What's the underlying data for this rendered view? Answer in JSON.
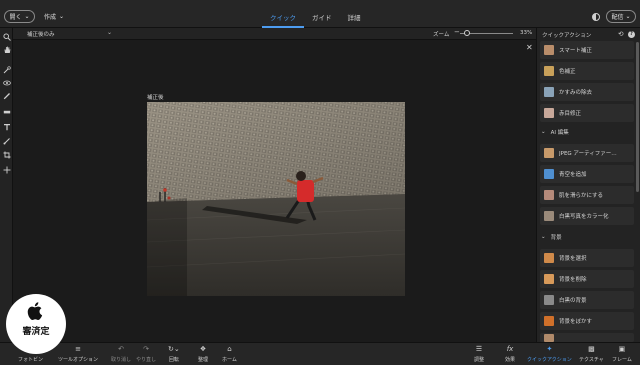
{
  "header": {
    "open_label": "開く",
    "create_label": "作成",
    "modes": [
      {
        "label": "クイック",
        "active": true
      },
      {
        "label": "ガイド",
        "active": false
      },
      {
        "label": "詳細",
        "active": false
      }
    ],
    "share_label": "配信"
  },
  "view_bar": {
    "view_mode": "補正後のみ",
    "zoom_label": "ズーム",
    "zoom_value": "33%",
    "zoom_fraction": 0.1
  },
  "canvas": {
    "after_label": "補正後"
  },
  "quick_actions": {
    "title": "クイックアクション",
    "items_top": [
      {
        "label": "スマート補正",
        "thumb_color": "#b98d6a"
      },
      {
        "label": "色補正",
        "thumb_color": "#c9a15a"
      },
      {
        "label": "かすみの除去",
        "thumb_color": "#8aa3b8"
      },
      {
        "label": "赤目修正",
        "thumb_color": "#c8a89a"
      }
    ],
    "ai_section": "AI 編集",
    "items_ai": [
      {
        "label": "JPEG アーティファー…",
        "thumb_color": "#c89a6a"
      },
      {
        "label": "青空を追加",
        "thumb_color": "#4f8fd0"
      },
      {
        "label": "肌を滑らかにする",
        "thumb_color": "#b58a7a"
      },
      {
        "label": "白黒写真をカラー化",
        "thumb_color": "#9a8a7a"
      }
    ],
    "bg_section": "背景",
    "items_bg": [
      {
        "label": "背景を選択",
        "thumb_color": "#d08a4a"
      },
      {
        "label": "背景を削除",
        "thumb_color": "#d89a5a"
      },
      {
        "label": "白黒の背景",
        "thumb_color": "#8a8a8a"
      },
      {
        "label": "背景をぼかす",
        "thumb_color": "#d0702a"
      }
    ]
  },
  "bottom_bar": {
    "left": [
      {
        "label": "フォトビン",
        "icon": "photo-bin-icon"
      },
      {
        "label": "ツールオプション",
        "icon": "tool-options-icon"
      },
      {
        "label": "取り消し",
        "icon": "undo-icon"
      },
      {
        "label": "やり直し",
        "icon": "redo-icon"
      },
      {
        "label": "回転",
        "icon": "rotate-icon"
      },
      {
        "label": "整理",
        "icon": "organizer-icon"
      },
      {
        "label": "ホーム",
        "icon": "home-icon"
      }
    ],
    "right": [
      {
        "label": "調整",
        "icon": "adjust-icon"
      },
      {
        "label": "効果",
        "icon": "effects-icon"
      },
      {
        "label": "クイックアクション",
        "icon": "quick-actions-icon"
      },
      {
        "label": "テクスチャ",
        "icon": "textures-icon"
      },
      {
        "label": "フレーム",
        "icon": "frames-icon"
      }
    ]
  },
  "watermark": {
    "text": "審済定"
  }
}
